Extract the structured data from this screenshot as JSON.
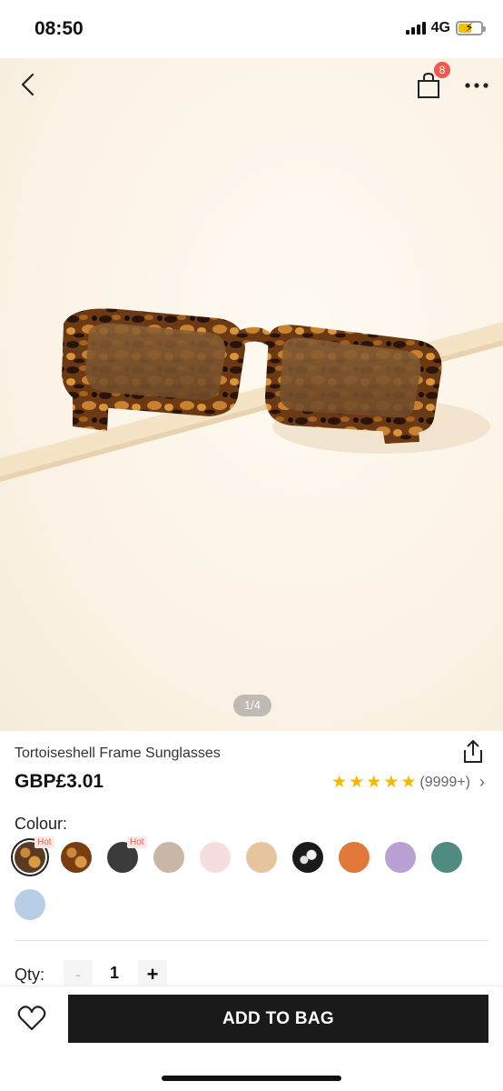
{
  "status_bar": {
    "time": "08:50",
    "network": "4G"
  },
  "header": {
    "bag_count": "8"
  },
  "gallery": {
    "page_indicator": "1/4"
  },
  "product": {
    "title": "Tortoiseshell Frame Sunglasses",
    "price": "GBP£3.01",
    "rating_stars": 5,
    "rating_count": "(9999+)"
  },
  "colour": {
    "label": "Colour:",
    "swatches": [
      {
        "name": "tortoiseshell-dark",
        "color": "#5b3a22",
        "hot": "Hot",
        "selected": true
      },
      {
        "name": "tortoiseshell",
        "color": "#7a3d12",
        "hot": ""
      },
      {
        "name": "dark-grey",
        "color": "#3b3b3b",
        "hot": "Hot"
      },
      {
        "name": "taupe",
        "color": "#c9b6a6",
        "hot": ""
      },
      {
        "name": "pale-pink",
        "color": "#f6dede",
        "hot": ""
      },
      {
        "name": "beige",
        "color": "#e6c49d",
        "hot": ""
      },
      {
        "name": "black-white",
        "color": "#1a1a1a",
        "hot": ""
      },
      {
        "name": "orange",
        "color": "#e07838",
        "hot": ""
      },
      {
        "name": "lilac",
        "color": "#b9a1d3",
        "hot": ""
      },
      {
        "name": "teal-green",
        "color": "#4f8b80",
        "hot": ""
      },
      {
        "name": "light-blue",
        "color": "#b7cfe6",
        "hot": ""
      }
    ]
  },
  "quantity": {
    "label": "Qty:",
    "minus": "-",
    "value": "1",
    "plus": "+"
  },
  "actions": {
    "add_to_bag": "ADD TO BAG"
  }
}
